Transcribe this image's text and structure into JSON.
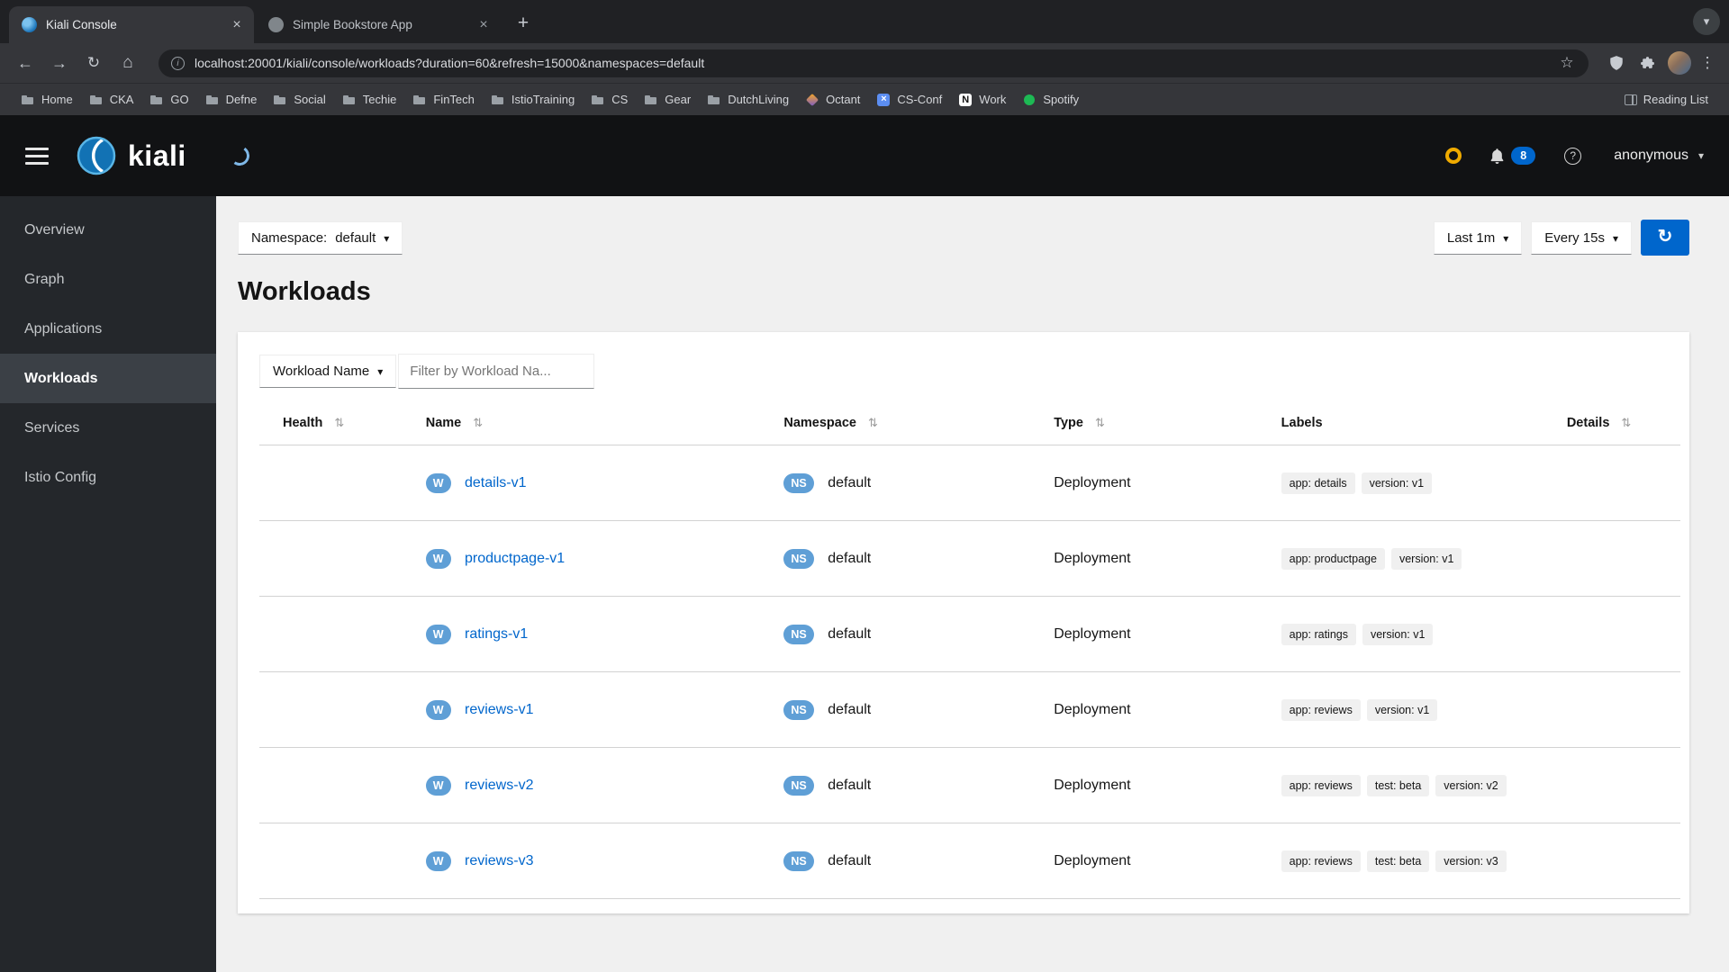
{
  "colors": {
    "primary": "#0066cc",
    "badge": "#5f9fd6",
    "notification": "#f0ab00"
  },
  "browser": {
    "tabs": [
      {
        "title": "Kiali Console",
        "active": true
      },
      {
        "title": "Simple Bookstore App",
        "active": false
      }
    ],
    "url": "localhost:20001/kiali/console/workloads?duration=60&refresh=15000&namespaces=default",
    "bookmarks": [
      {
        "label": "Home",
        "icon": "folder"
      },
      {
        "label": "CKA",
        "icon": "folder"
      },
      {
        "label": "GO",
        "icon": "folder"
      },
      {
        "label": "Defne",
        "icon": "folder"
      },
      {
        "label": "Social",
        "icon": "folder"
      },
      {
        "label": "Techie",
        "icon": "folder"
      },
      {
        "label": "FinTech",
        "icon": "folder"
      },
      {
        "label": "IstioTraining",
        "icon": "folder"
      },
      {
        "label": "CS",
        "icon": "folder"
      },
      {
        "label": "Gear",
        "icon": "folder"
      },
      {
        "label": "DutchLiving",
        "icon": "folder"
      },
      {
        "label": "Octant",
        "icon": "octant"
      },
      {
        "label": "CS-Conf",
        "icon": "csconf"
      },
      {
        "label": "Work",
        "icon": "notion"
      },
      {
        "label": "Spotify",
        "icon": "spotify"
      }
    ],
    "reading_list": "Reading List"
  },
  "masthead": {
    "brand": "kiali",
    "notification_count": "8",
    "username": "anonymous"
  },
  "sidebar": {
    "items": [
      {
        "label": "Overview",
        "active": false
      },
      {
        "label": "Graph",
        "active": false
      },
      {
        "label": "Applications",
        "active": false
      },
      {
        "label": "Workloads",
        "active": true
      },
      {
        "label": "Services",
        "active": false
      },
      {
        "label": "Istio Config",
        "active": false
      }
    ]
  },
  "content": {
    "namespace_label": "Namespace:",
    "namespace_value": "default",
    "duration_value": "Last 1m",
    "refresh_value": "Every 15s",
    "title": "Workloads",
    "filter_label": "Workload Name",
    "filter_placeholder": "Filter by Workload Na...",
    "table": {
      "workload_badge": "W",
      "namespace_badge": "NS",
      "columns": [
        {
          "label": "Health",
          "sortable": true
        },
        {
          "label": "Name",
          "sortable": true
        },
        {
          "label": "Namespace",
          "sortable": true
        },
        {
          "label": "Type",
          "sortable": true
        },
        {
          "label": "Labels",
          "sortable": false
        },
        {
          "label": "Details",
          "sortable": true
        }
      ],
      "rows": [
        {
          "name": "details-v1",
          "namespace": "default",
          "type": "Deployment",
          "labels": [
            "app: details",
            "version: v1"
          ]
        },
        {
          "name": "productpage-v1",
          "namespace": "default",
          "type": "Deployment",
          "labels": [
            "app: productpage",
            "version: v1"
          ]
        },
        {
          "name": "ratings-v1",
          "namespace": "default",
          "type": "Deployment",
          "labels": [
            "app: ratings",
            "version: v1"
          ]
        },
        {
          "name": "reviews-v1",
          "namespace": "default",
          "type": "Deployment",
          "labels": [
            "app: reviews",
            "version: v1"
          ]
        },
        {
          "name": "reviews-v2",
          "namespace": "default",
          "type": "Deployment",
          "labels": [
            "app: reviews",
            "test: beta",
            "version: v2"
          ]
        },
        {
          "name": "reviews-v3",
          "namespace": "default",
          "type": "Deployment",
          "labels": [
            "app: reviews",
            "test: beta",
            "version: v3"
          ]
        }
      ]
    }
  }
}
